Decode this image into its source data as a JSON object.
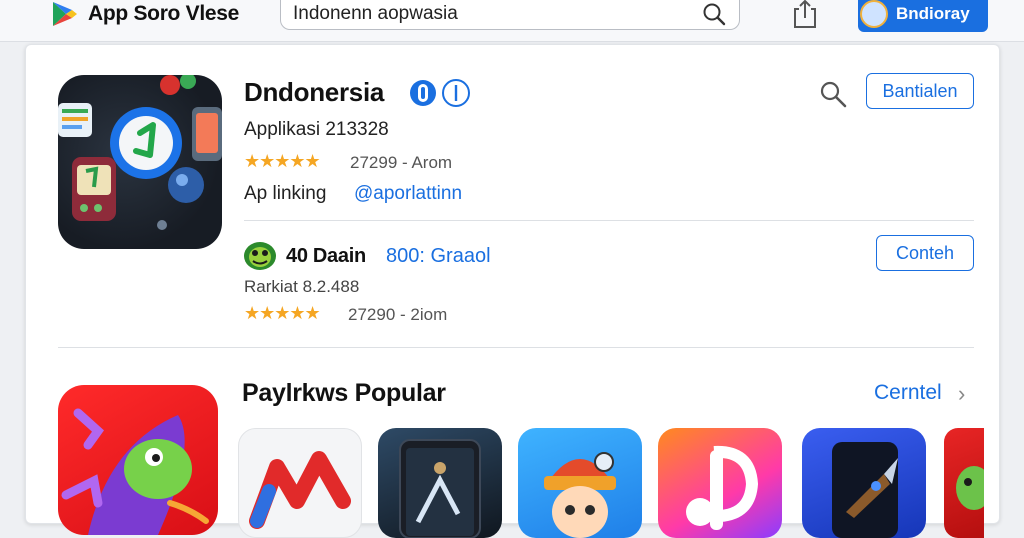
{
  "header": {
    "brand": "App Soro Vlese",
    "search_value": "Indonenn aopwasia",
    "profile_label": "Bndioray"
  },
  "app": {
    "title": "Dndonersia",
    "subtitle": "Applikasi 213328",
    "stars": "★★★★★",
    "rating_meta": "27299 - Arom",
    "dev_label": "Ap linking",
    "dev_link": "@aporlattinn",
    "action_label": "Bantialen"
  },
  "game": {
    "title": "40 Daain",
    "price": "800: Graaol",
    "subtitle": "Rarkiat 8.2.488",
    "stars": "★★★★★",
    "rating_meta": "27290 - 2iom",
    "action_label": "Conteh"
  },
  "popular": {
    "title": "Paylrkws Popular",
    "link_label": "Cerntel",
    "chevron": "›"
  },
  "colors": {
    "accent": "#1a6fe0",
    "star": "#f5a623"
  }
}
